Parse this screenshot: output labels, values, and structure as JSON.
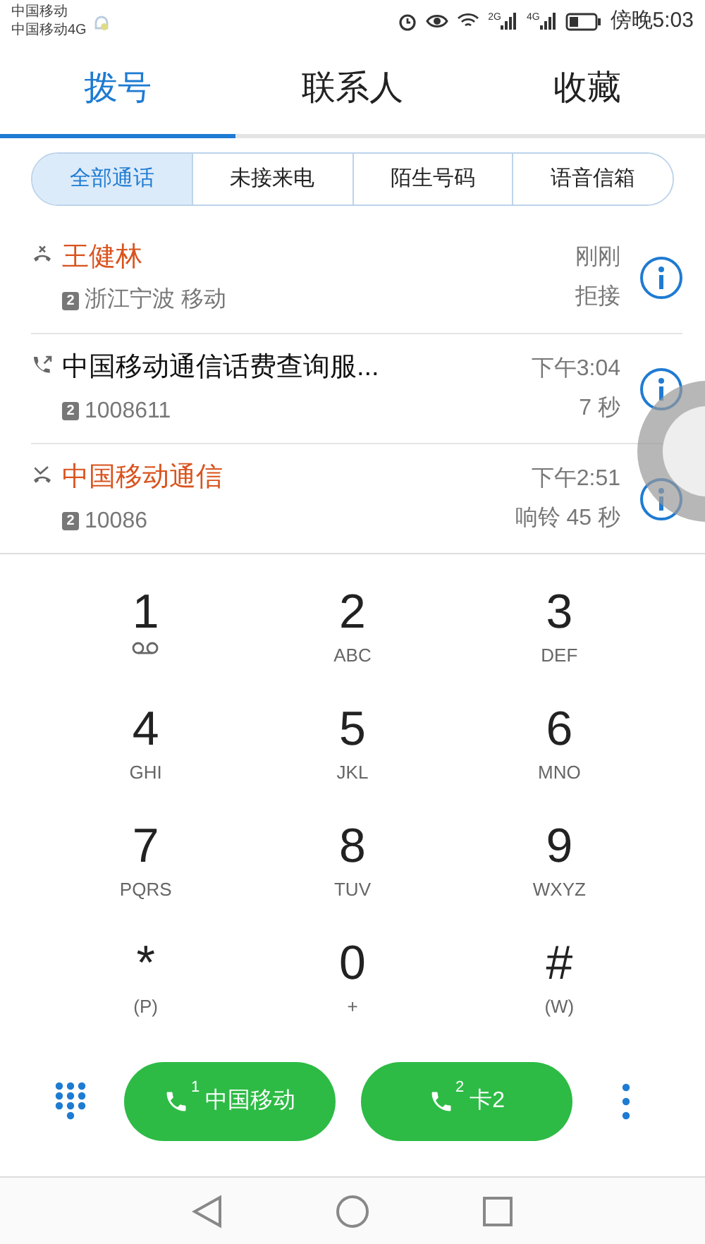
{
  "status_bar": {
    "carriers": [
      "中国移动",
      "中国移动4G"
    ],
    "signals": [
      "2G",
      "4G"
    ],
    "time": "傍晚5:03"
  },
  "tabs": [
    {
      "label": "拨号",
      "selected": true
    },
    {
      "label": "联系人",
      "selected": false
    },
    {
      "label": "收藏",
      "selected": false
    }
  ],
  "filters": [
    {
      "label": "全部通话",
      "selected": true
    },
    {
      "label": "未接来电",
      "selected": false
    },
    {
      "label": "陌生号码",
      "selected": false
    },
    {
      "label": "语音信箱",
      "selected": false
    }
  ],
  "calls": [
    {
      "kind": "rejected",
      "name": "王健林",
      "sim": "2",
      "detail": "浙江宁波 移动",
      "time": "刚刚",
      "note": "拒接"
    },
    {
      "kind": "outgoing",
      "name": "中国移动通信话费查询服...",
      "sim": "2",
      "detail": "1008611",
      "time": "下午3:04",
      "note": "7 秒"
    },
    {
      "kind": "missed",
      "name": "中国移动通信",
      "sim": "2",
      "detail": "10086",
      "time": "下午2:51",
      "note": "响铃 45 秒"
    }
  ],
  "keypad": [
    {
      "digit": "1",
      "kind": "voicemail"
    },
    {
      "digit": "2",
      "letters": "ABC"
    },
    {
      "digit": "3",
      "letters": "DEF"
    },
    {
      "digit": "4",
      "letters": "GHI"
    },
    {
      "digit": "5",
      "letters": "JKL"
    },
    {
      "digit": "6",
      "letters": "MNO"
    },
    {
      "digit": "7",
      "letters": "PQRS"
    },
    {
      "digit": "8",
      "letters": "TUV"
    },
    {
      "digit": "9",
      "letters": "WXYZ"
    },
    {
      "digit": "*",
      "letters": "(P)"
    },
    {
      "digit": "0",
      "letters": "+"
    },
    {
      "digit": "#",
      "letters": "(W)"
    }
  ],
  "call_buttons": [
    {
      "sim": "1",
      "label": "中国移动"
    },
    {
      "sim": "2",
      "label": "卡2"
    }
  ]
}
